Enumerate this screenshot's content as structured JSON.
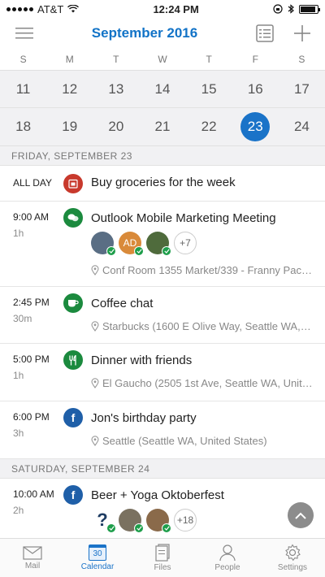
{
  "status": {
    "carrier": "AT&T",
    "time": "12:24 PM"
  },
  "header": {
    "title": "September 2016"
  },
  "weekdays": [
    "S",
    "M",
    "T",
    "W",
    "T",
    "F",
    "S"
  ],
  "weeks": [
    [
      "11",
      "12",
      "13",
      "14",
      "15",
      "16",
      "17"
    ],
    [
      "18",
      "19",
      "20",
      "21",
      "22",
      "23",
      "24"
    ]
  ],
  "selected_day": "23",
  "sections": [
    {
      "label": "FRIDAY, SEPTEMBER 23",
      "events": [
        {
          "time": "ALL DAY",
          "duration": "",
          "title": "Buy groceries for the week",
          "icon": "calendar-icon",
          "color": "#c8392c",
          "location": ""
        },
        {
          "time": "9:00 AM",
          "duration": "1h",
          "title": "Outlook Mobile Marketing Meeting",
          "icon": "chat-icon",
          "color": "#1b8a3e",
          "location": "Conf Room 1355 Market/339 - Franny Pac…",
          "attendees": [
            "",
            "AD",
            ""
          ],
          "more": "+7"
        },
        {
          "time": "2:45 PM",
          "duration": "30m",
          "title": "Coffee chat",
          "icon": "coffee-icon",
          "color": "#1b8a3e",
          "location": "Starbucks (1600 E Olive Way, Seattle WA,…"
        },
        {
          "time": "5:00 PM",
          "duration": "1h",
          "title": "Dinner with friends",
          "icon": "utensils-icon",
          "color": "#1b8a3e",
          "location": "El Gaucho (2505 1st Ave, Seattle WA, Unit…"
        },
        {
          "time": "6:00 PM",
          "duration": "3h",
          "title": "Jon's birthday party",
          "icon": "facebook-icon",
          "color": "#1f5fa8",
          "location": "Seattle (Seattle WA, United States)"
        }
      ]
    },
    {
      "label": "SATURDAY, SEPTEMBER 24",
      "events": [
        {
          "time": "10:00 AM",
          "duration": "2h",
          "title": "Beer + Yoga Oktoberfest",
          "icon": "facebook-icon",
          "color": "#1f5fa8",
          "more": "+18"
        }
      ]
    }
  ],
  "tabs": [
    {
      "label": "Mail",
      "icon": "mail-icon"
    },
    {
      "label": "Calendar",
      "icon": "calendar-icon",
      "badge": "30"
    },
    {
      "label": "Files",
      "icon": "files-icon"
    },
    {
      "label": "People",
      "icon": "people-icon"
    },
    {
      "label": "Settings",
      "icon": "settings-icon"
    }
  ],
  "colors": {
    "accent": "#1a73c8"
  }
}
